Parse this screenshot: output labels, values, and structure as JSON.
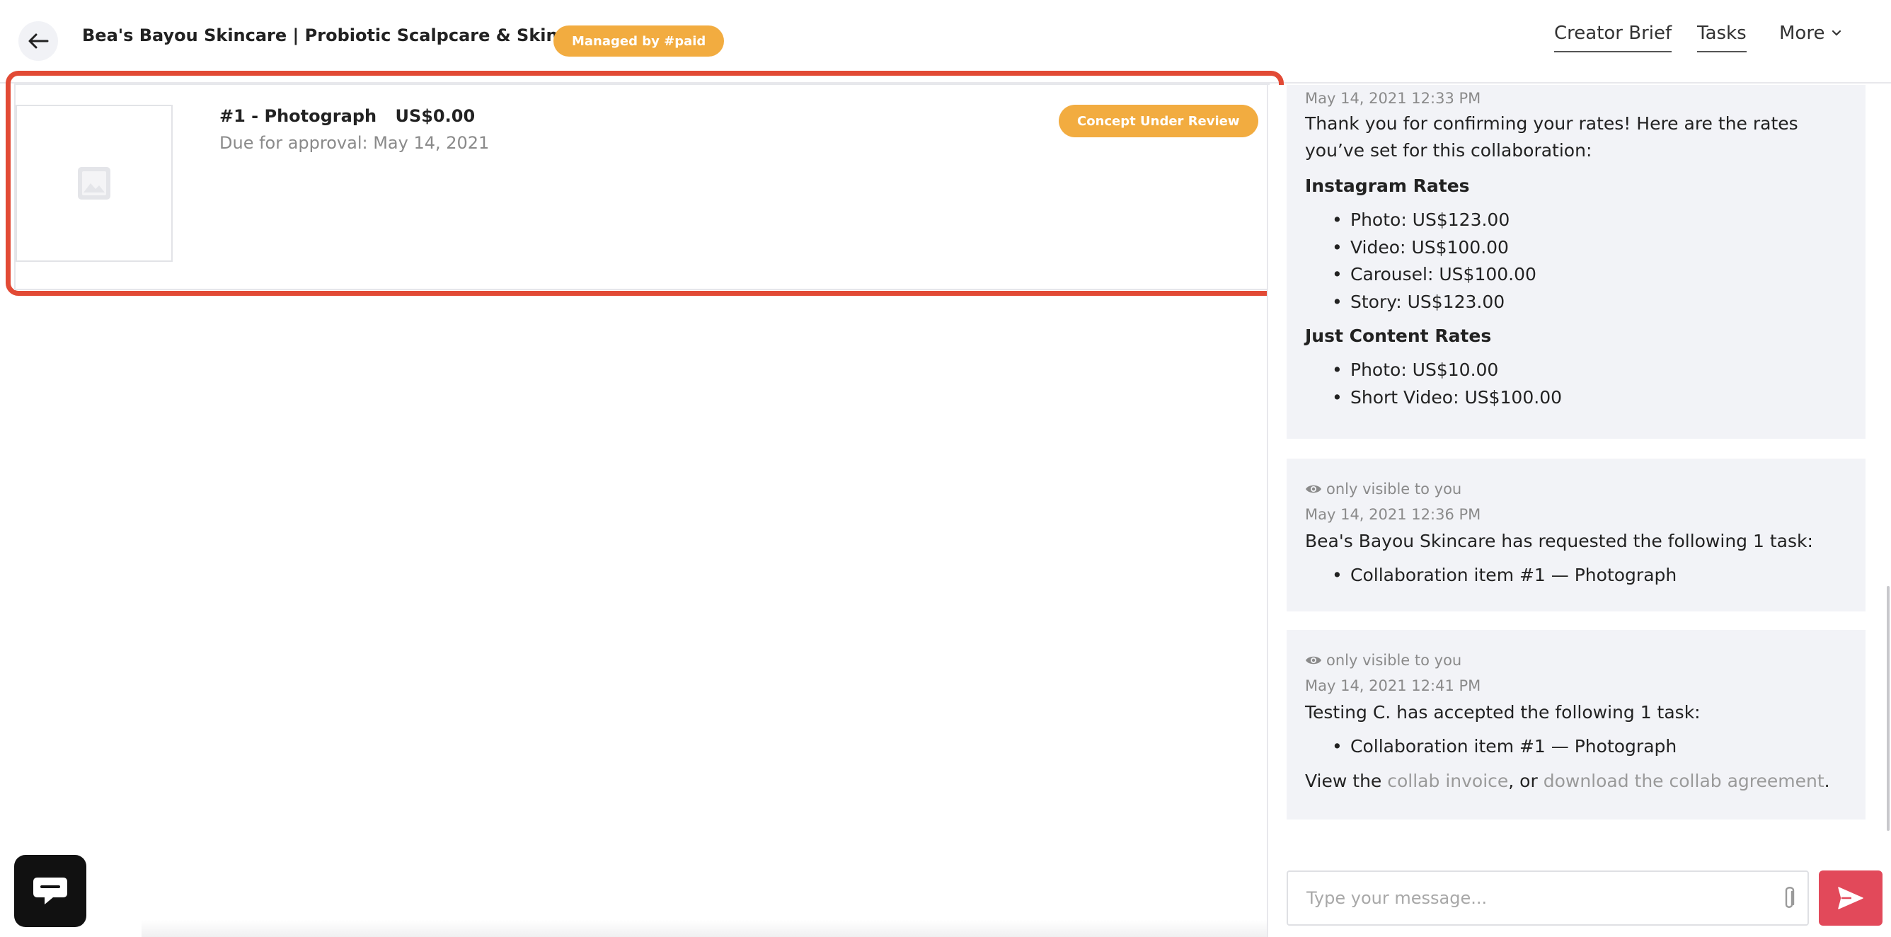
{
  "header": {
    "title": "Bea's Bayou Skincare | Probiotic Scalpcare & Skincare",
    "managed_badge": "Managed by #paid",
    "nav": {
      "creator_brief": "Creator Brief",
      "tasks": "Tasks",
      "more": "More"
    }
  },
  "task": {
    "number_title": "#1 - Photograph",
    "price": "US$0.00",
    "due": "Due for approval: May 14, 2021",
    "status": "Concept Under Review"
  },
  "messages": [
    {
      "time": "May 14, 2021 12:33 PM",
      "intro": "Thank you for confirming your rates! Here are the rates you’ve set for this collaboration:",
      "sections": [
        {
          "heading": "Instagram Rates",
          "items": [
            "Photo: US$123.00",
            "Video: US$100.00",
            "Carousel: US$100.00",
            "Story: US$123.00"
          ]
        },
        {
          "heading": "Just Content Rates",
          "items": [
            "Photo: US$10.00",
            "Short Video: US$100.00"
          ]
        }
      ]
    },
    {
      "visibility": "only visible to you",
      "time": "May 14, 2021 12:36 PM",
      "text": "Bea's Bayou Skincare has requested the following 1 task:",
      "items": [
        "Collaboration item #1 — Photograph"
      ]
    },
    {
      "visibility": "only visible to you",
      "time": "May 14, 2021 12:41 PM",
      "text": "Testing C. has accepted the following 1 task:",
      "items": [
        "Collaboration item #1 — Photograph"
      ],
      "footer": {
        "prefix": "View the ",
        "invoice_link": "collab invoice",
        "middle": ", or ",
        "agreement_link": "download the collab agreement",
        "suffix": "."
      }
    }
  ],
  "composer": {
    "placeholder": "Type your message..."
  },
  "icons": {
    "back": "arrow-left-icon",
    "more": "chevron-down-icon",
    "thumbnail": "image-placeholder-icon",
    "visibility": "eye-icon",
    "attach": "paperclip-icon",
    "send": "send-icon",
    "chat": "chat-bubble-icon"
  },
  "colors": {
    "badge": "#f2ac40",
    "highlight": "#e24a35",
    "send": "#e2495a",
    "message_bg": "#f2f3f7"
  }
}
